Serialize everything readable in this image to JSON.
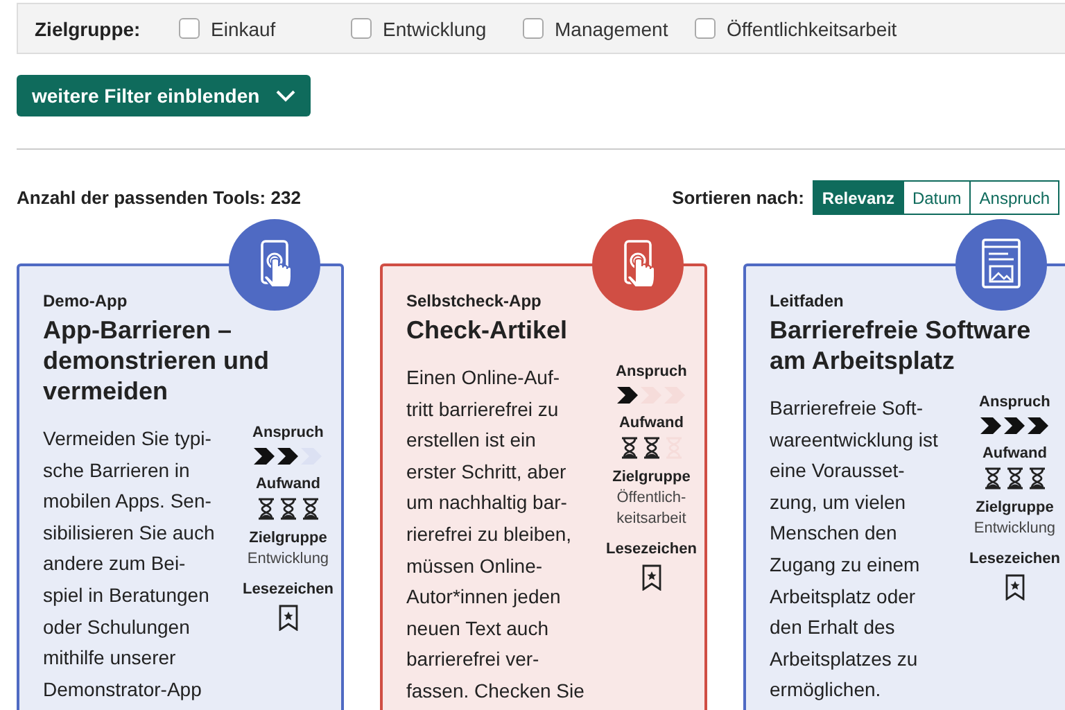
{
  "filter": {
    "label": "Zielgruppe:",
    "options": [
      {
        "label": "Einkauf",
        "checked": false
      },
      {
        "label": "Entwicklung",
        "checked": false
      },
      {
        "label": "Management",
        "checked": false
      },
      {
        "label": "Öffentlichkeitsarbeit",
        "checked": false
      }
    ]
  },
  "more_filters_button": "weitere Filter einblenden",
  "result_count": "Anzahl der passenden Tools: 232",
  "sort": {
    "label": "Sortieren nach:",
    "options": [
      {
        "label": "Relevanz",
        "selected": true
      },
      {
        "label": "Datum",
        "selected": false
      },
      {
        "label": "Anspruch",
        "selected": false
      }
    ]
  },
  "cards": [
    {
      "kind": "app",
      "color": "#4f6ac3",
      "category": "Demo-App",
      "title": "App-Barrieren – demonstrieren und vermeiden",
      "lines": [
        "Vermeiden Sie typi-",
        "sche Barrieren in",
        "mobilen Apps. Sen-",
        "sibilisieren Sie auch",
        "andere zum Bei-",
        "spiel in Beratungen",
        "oder Schulungen",
        "mithilfe unserer",
        "Demonstrator-App"
      ],
      "difficulty": {
        "label": "Anspruch",
        "steps": [
          {
            "filled": true
          },
          {
            "filled": true
          },
          {
            "filled": false
          }
        ]
      },
      "effort": {
        "label": "Aufwand",
        "steps": [
          {
            "filled": true
          },
          {
            "filled": true
          },
          {
            "filled": true
          }
        ]
      },
      "audience": {
        "label": "Zielgruppe",
        "lines": [
          "Entwicklung"
        ]
      },
      "bookmark": {
        "label": "Lesezeichen"
      }
    },
    {
      "kind": "app",
      "color": "#d04e44",
      "category": "Selbstcheck-App",
      "title": "Check-Artikel",
      "lines": [
        "Einen Online-Auf-",
        "tritt barrierefrei zu",
        "erstellen ist ein",
        "erster Schritt, aber",
        "um nachhaltig bar-",
        "rierefrei zu bleiben,",
        "müssen Online-",
        "Autor*innen jeden",
        "neuen Text auch",
        "barrierefrei ver-",
        "fassen. Checken Sie"
      ],
      "difficulty": {
        "label": "Anspruch",
        "steps": [
          {
            "filled": true
          },
          {
            "filled": false
          },
          {
            "filled": false
          }
        ]
      },
      "effort": {
        "label": "Aufwand",
        "steps": [
          {
            "filled": true
          },
          {
            "filled": true
          },
          {
            "filled": false
          }
        ]
      },
      "audience": {
        "label": "Zielgruppe",
        "lines": [
          "Öffentlich-",
          "keitsarbeit"
        ]
      },
      "bookmark": {
        "label": "Lesezeichen"
      }
    },
    {
      "kind": "guide",
      "color": "#4f6ac3",
      "category": "Leitfaden",
      "title": "Barrierefreie Software am Arbeitsplatz",
      "lines": [
        "Barrierefreie Soft-",
        "wareentwicklung ist",
        "eine Vorausset-",
        "zung, um vielen",
        "Menschen den",
        "Zugang zu einem",
        "Arbeitsplatz oder",
        "den Erhalt des",
        "Arbeitsplatzes zu",
        "ermöglichen."
      ],
      "difficulty": {
        "label": "Anspruch",
        "steps": [
          {
            "filled": true
          },
          {
            "filled": true
          },
          {
            "filled": true
          }
        ]
      },
      "effort": {
        "label": "Aufwand",
        "steps": [
          {
            "filled": true
          },
          {
            "filled": true
          },
          {
            "filled": true
          }
        ]
      },
      "audience": {
        "label": "Zielgruppe",
        "lines": [
          "Entwicklung"
        ]
      },
      "bookmark": {
        "label": "Lesezeichen"
      }
    }
  ]
}
